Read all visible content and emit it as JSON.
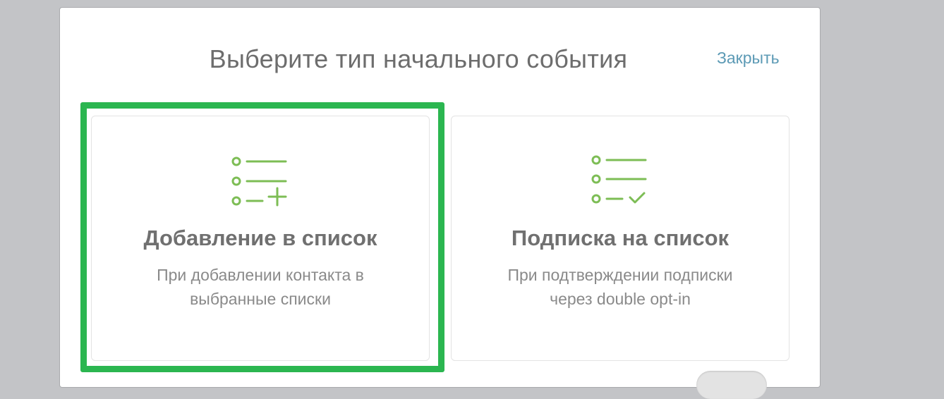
{
  "dialog": {
    "title": "Выберите тип начального события",
    "close_label": "Закрыть"
  },
  "cards": [
    {
      "title": "Добавление в список",
      "description_line1": "При добавлении контакта в",
      "description_line2": "выбранные списки",
      "icon": "list-add-icon",
      "selected": true
    },
    {
      "title": "Подписка на список",
      "description_line1": "При подтверждении подписки",
      "description_line2": "через double opt-in",
      "icon": "list-check-icon",
      "selected": false
    }
  ],
  "colors": {
    "background": "#c3c4c7",
    "accent_icon": "#7dbd55",
    "highlight": "#2bb650",
    "link": "#5c9ab5",
    "title_text": "#6d6d6d"
  }
}
